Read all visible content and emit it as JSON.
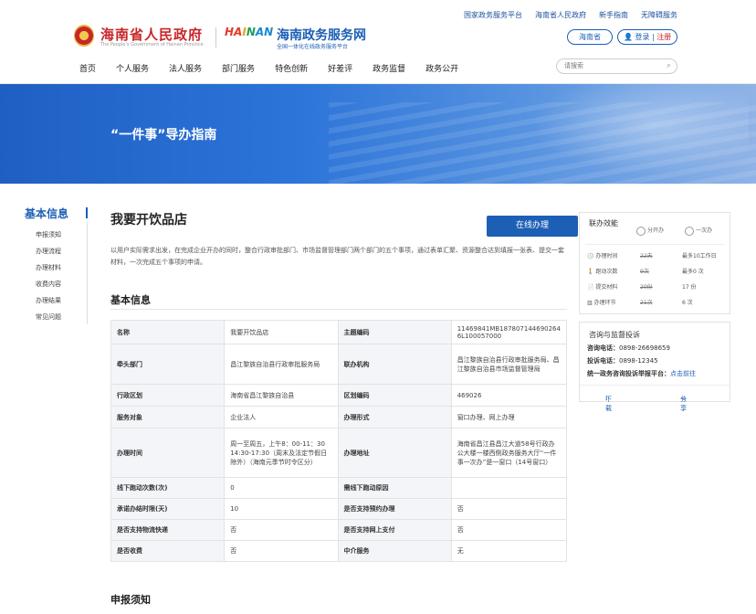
{
  "header": {
    "toplinks": [
      "国家政务服务平台",
      "海南省人民政府",
      "新手指南",
      "无障碍服务"
    ],
    "gov_name": "海南省人民政府",
    "gov_sub": "The People's Government of Hainan Province",
    "hn_logo": "HAINAN",
    "site_name": "海南政务服务网",
    "site_sub": "全国一体化在线政务服务平台",
    "region": "海南省",
    "login": "登录",
    "register": "注册",
    "nav": [
      "首页",
      "个人服务",
      "法人服务",
      "部门服务",
      "特色创新",
      "好差评",
      "政务监督",
      "政务公开"
    ],
    "search_placeholder": "请搜索"
  },
  "banner": {
    "title": "“一件事”导办指南"
  },
  "sidebar": {
    "heading": "基本信息",
    "items": [
      "申报须知",
      "办理流程",
      "办理材料",
      "收费内容",
      "办理结果",
      "常见问题"
    ]
  },
  "main": {
    "title": "我要开饮品店",
    "button": "在线办理",
    "description": "以用户实际需求出发，在完成企业开办的同时，整合行政审批部门、市场监督管理部门两个部门的五个事项，通过表单汇聚、资源整合达到填报一张表、提交一套材料，一次完成五个事项的申请。",
    "section": "基本信息",
    "table": [
      [
        "名称",
        "我要开饮品店",
        "主题编码",
        "11469841MB187807144690264 6L100057000"
      ],
      [
        "牵头部门",
        "昌江黎族自治县行政审批服务局",
        "联办机构",
        "昌江黎族自治县行政审批服务局、昌江黎族自治县市场监督管理局"
      ],
      [
        "行政区划",
        "海南省昌江黎族自治县",
        "区划编码",
        "469026"
      ],
      [
        "服务对象",
        "企业法人",
        "办理形式",
        "窗口办理、网上办理"
      ],
      [
        "办理时间",
        "周一至周五，上午8：00-11：30 14:30-17:30（周末及法定节假日除外）（海南元季节时令区分）",
        "办理地址",
        "海南省昌江县昌江大道58号行政办公大楼一楼西侧政务服务大厅“一件事一次办”是一窗口（14号窗口）"
      ],
      [
        "线下跑动次数(次)",
        "0",
        "需线下跑动原因",
        ""
      ],
      [
        "承诺办结时限(天)",
        "10",
        "是否支持预约办理",
        "否"
      ],
      [
        "是否支持物流快递",
        "否",
        "是否支持网上支付",
        "否"
      ],
      [
        "是否收费",
        "否",
        "中介服务",
        "无"
      ]
    ],
    "section2": "申报须知"
  },
  "effect": {
    "title": "联办效能",
    "opt1": "分开办",
    "opt2": "一次办",
    "rows": [
      [
        "办理时间",
        "22天",
        "最多10工作日"
      ],
      [
        "跑动次数",
        "9次",
        "最多0 次"
      ],
      [
        "提交材料",
        "20份",
        "17 份"
      ],
      [
        "办理环节",
        "21次",
        "6 次"
      ]
    ]
  },
  "contact": {
    "title": "咨询与监督投诉",
    "consult_label": "咨询电话：",
    "consult": "0898-26698659",
    "complaint_label": "投诉电话：",
    "complaint": "0898-12345",
    "platform_label": "统一政务咨询投诉举报平台：",
    "platform_link": "点击前往",
    "download": "下载",
    "share": "分享"
  }
}
